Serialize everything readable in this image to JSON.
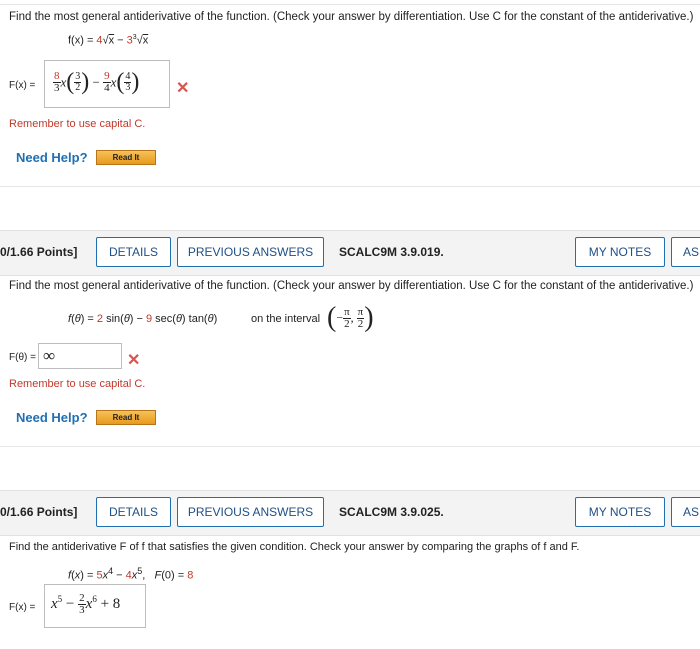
{
  "problem1": {
    "prompt": "Find the most general antiderivative of the function. (Check your answer by differentiation. Use C for the constant of the antiderivative.)",
    "function": "f(x) = 4√x − 3∛x",
    "answer_label": "F(x) =",
    "answer_value": "8/3 x^(3/2) − 9/4 x^(4/3)",
    "reminder": "Remember to use capital C.",
    "need_help": "Need Help?",
    "read_it": "Read It"
  },
  "problem2": {
    "points": "0/1.66 Points]",
    "buttons": [
      "DETAILS",
      "PREVIOUS ANSWERS",
      "MY NOTES",
      "AS"
    ],
    "code": "SCALC9M 3.9.019.",
    "prompt": "Find the most general antiderivative of the function. (Check your answer by differentiation. Use C for the constant of the antiderivative.)",
    "function": "f(θ) = 2 sin(θ) − 9 sec(θ) tan(θ)",
    "interval_text": "on the interval",
    "interval": "(−π/2, π/2)",
    "answer_label": "F(θ) =",
    "answer_value": "∞",
    "reminder": "Remember to use capital C.",
    "need_help": "Need Help?",
    "read_it": "Read It"
  },
  "problem3": {
    "points": "0/1.66 Points]",
    "buttons": [
      "DETAILS",
      "PREVIOUS ANSWERS",
      "MY NOTES",
      "AS"
    ],
    "code": "SCALC9M 3.9.025.",
    "prompt": "Find the antiderivative F of f that satisfies the given condition. Check your answer by comparing the graphs of f and F.",
    "function": "f(x) = 5x⁴ − 4x⁵,   F(0) = 8",
    "answer_label": "F(x) =",
    "answer_value": "x^5 − 2/3 x^6 + 8"
  },
  "colors": {
    "accent_blue": "#1f6fb2",
    "error_red": "#d9534f",
    "reminder_red": "#c0392b",
    "bar_gray": "#f3f3f3"
  }
}
